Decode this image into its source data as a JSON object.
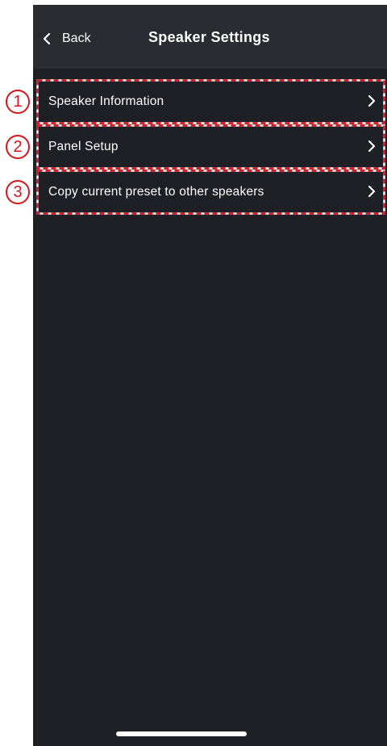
{
  "nav": {
    "back_label": "Back",
    "title": "Speaker Settings"
  },
  "menu": {
    "items": [
      {
        "label": "Speaker Information",
        "callout": "1"
      },
      {
        "label": "Panel Setup",
        "callout": "2"
      },
      {
        "label": "Copy current preset to other speakers",
        "callout": "3"
      }
    ]
  },
  "colors": {
    "background": "#1f1f26",
    "navbar": "#2b2c31",
    "text": "#ffffff",
    "annotation": "#d7141d"
  },
  "icons": {
    "back": "chevron-left-icon",
    "row": "chevron-right-icon"
  }
}
